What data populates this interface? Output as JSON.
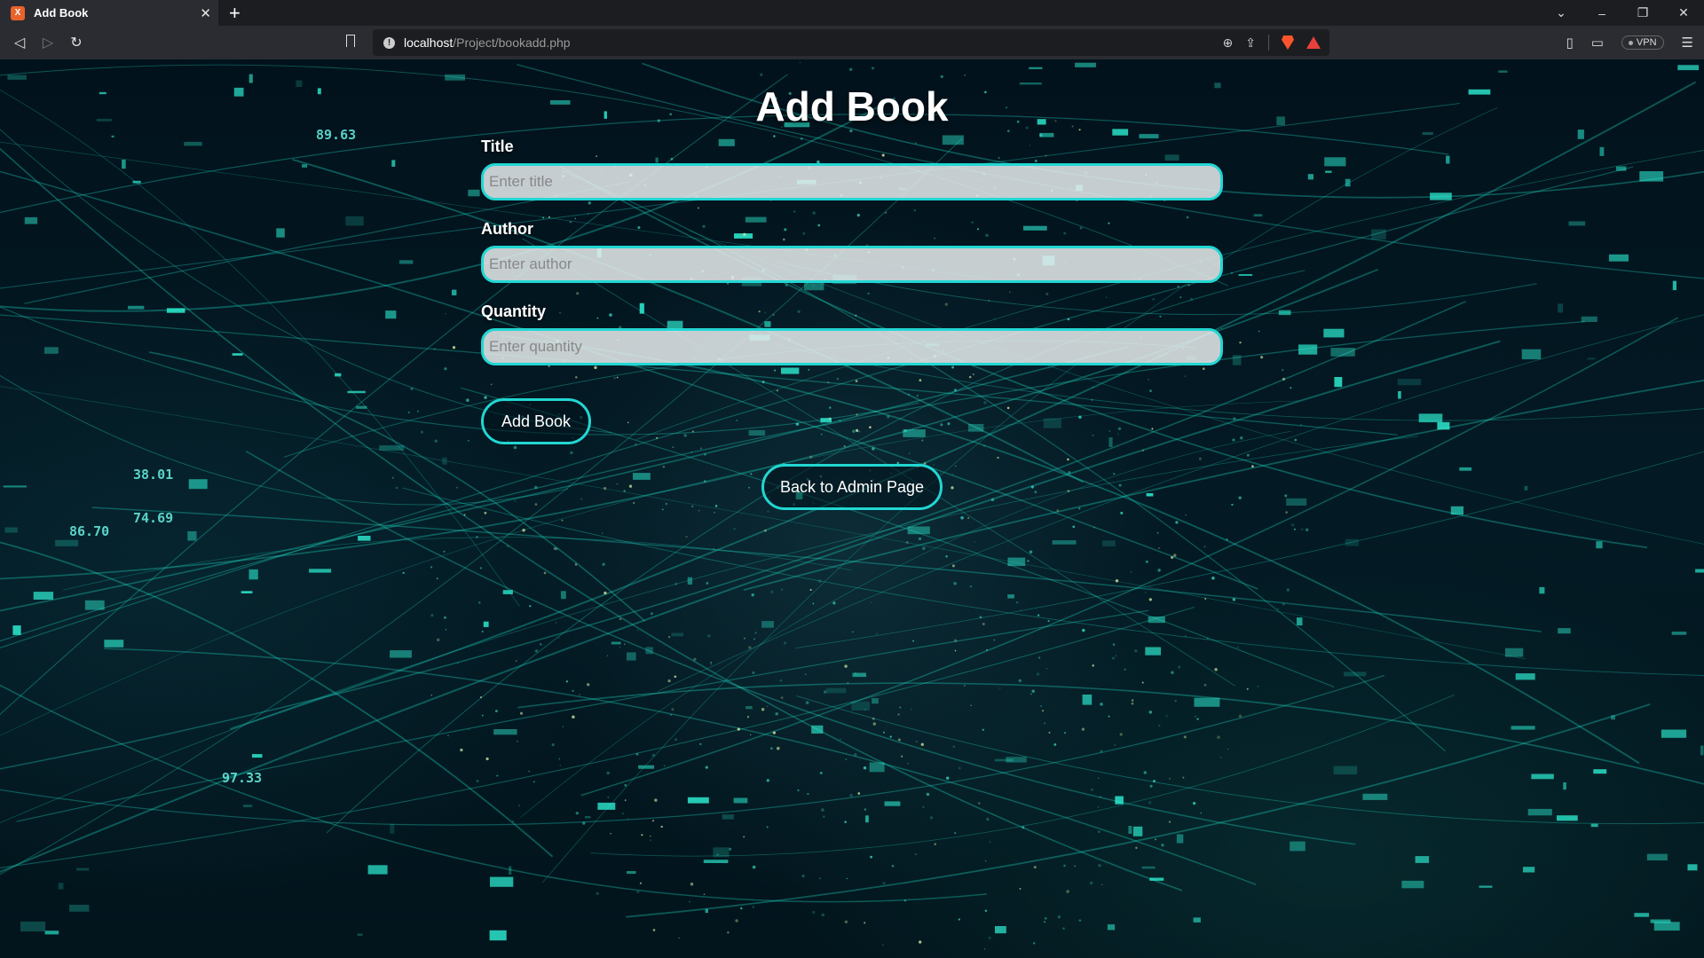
{
  "browser": {
    "tab_title": "Add Book",
    "tab_favicon_letter": "X",
    "url_host": "localhost",
    "url_path": "/Project/bookadd.php",
    "vpn_label": "VPN"
  },
  "page": {
    "title": "Add Book",
    "fields": [
      {
        "label": "Title",
        "placeholder": "Enter title"
      },
      {
        "label": "Author",
        "placeholder": "Enter author"
      },
      {
        "label": "Quantity",
        "placeholder": "Enter quantity"
      }
    ],
    "submit_label": "Add Book",
    "back_label": "Back to Admin Page"
  },
  "background_numbers": [
    "89.63",
    "86.70",
    "74.69",
    "97.33",
    "38.01"
  ],
  "colors": {
    "accent": "#22d6d2",
    "page_bg": "#02121c",
    "chrome_bg": "#2b2c31"
  }
}
